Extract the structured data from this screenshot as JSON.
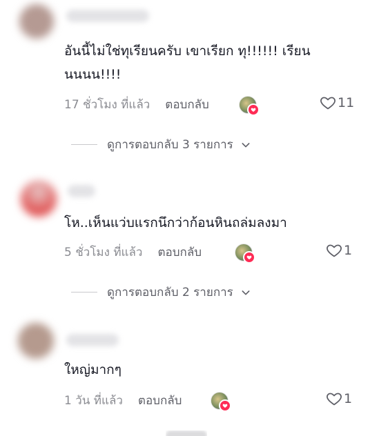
{
  "comments": [
    {
      "text": "อันนี้ไม่ใช่ทุเรียนครับ เขาเรียก ทุ!!!!!! เรียนนนนน!!!!",
      "time": "17 ชั่วโมง ที่แล้ว",
      "reply_label": "ตอบกลับ",
      "likes": "11",
      "view_replies": "ดูการตอบกลับ 3 รายการ"
    },
    {
      "text": "โห..เห็นแว่บแรกนึกว่าก้อนหินถล่มลงมา",
      "time": "5 ชั่วโมง ที่แล้ว",
      "reply_label": "ตอบกลับ",
      "likes": "1",
      "view_replies": "ดูการตอบกลับ 2 รายการ"
    },
    {
      "text": "ใหญ่มากๆ",
      "time": "1 วัน ที่แล้ว",
      "reply_label": "ตอบกลับ",
      "likes": "1"
    }
  ],
  "icons": {
    "like": "heart-outline-icon",
    "expand": "chevron-down-icon",
    "creator_liked": "creator-heart-badge-icon"
  },
  "colors": {
    "text": "#161823",
    "muted": "#8a8b91",
    "accent": "#fe2c55"
  }
}
